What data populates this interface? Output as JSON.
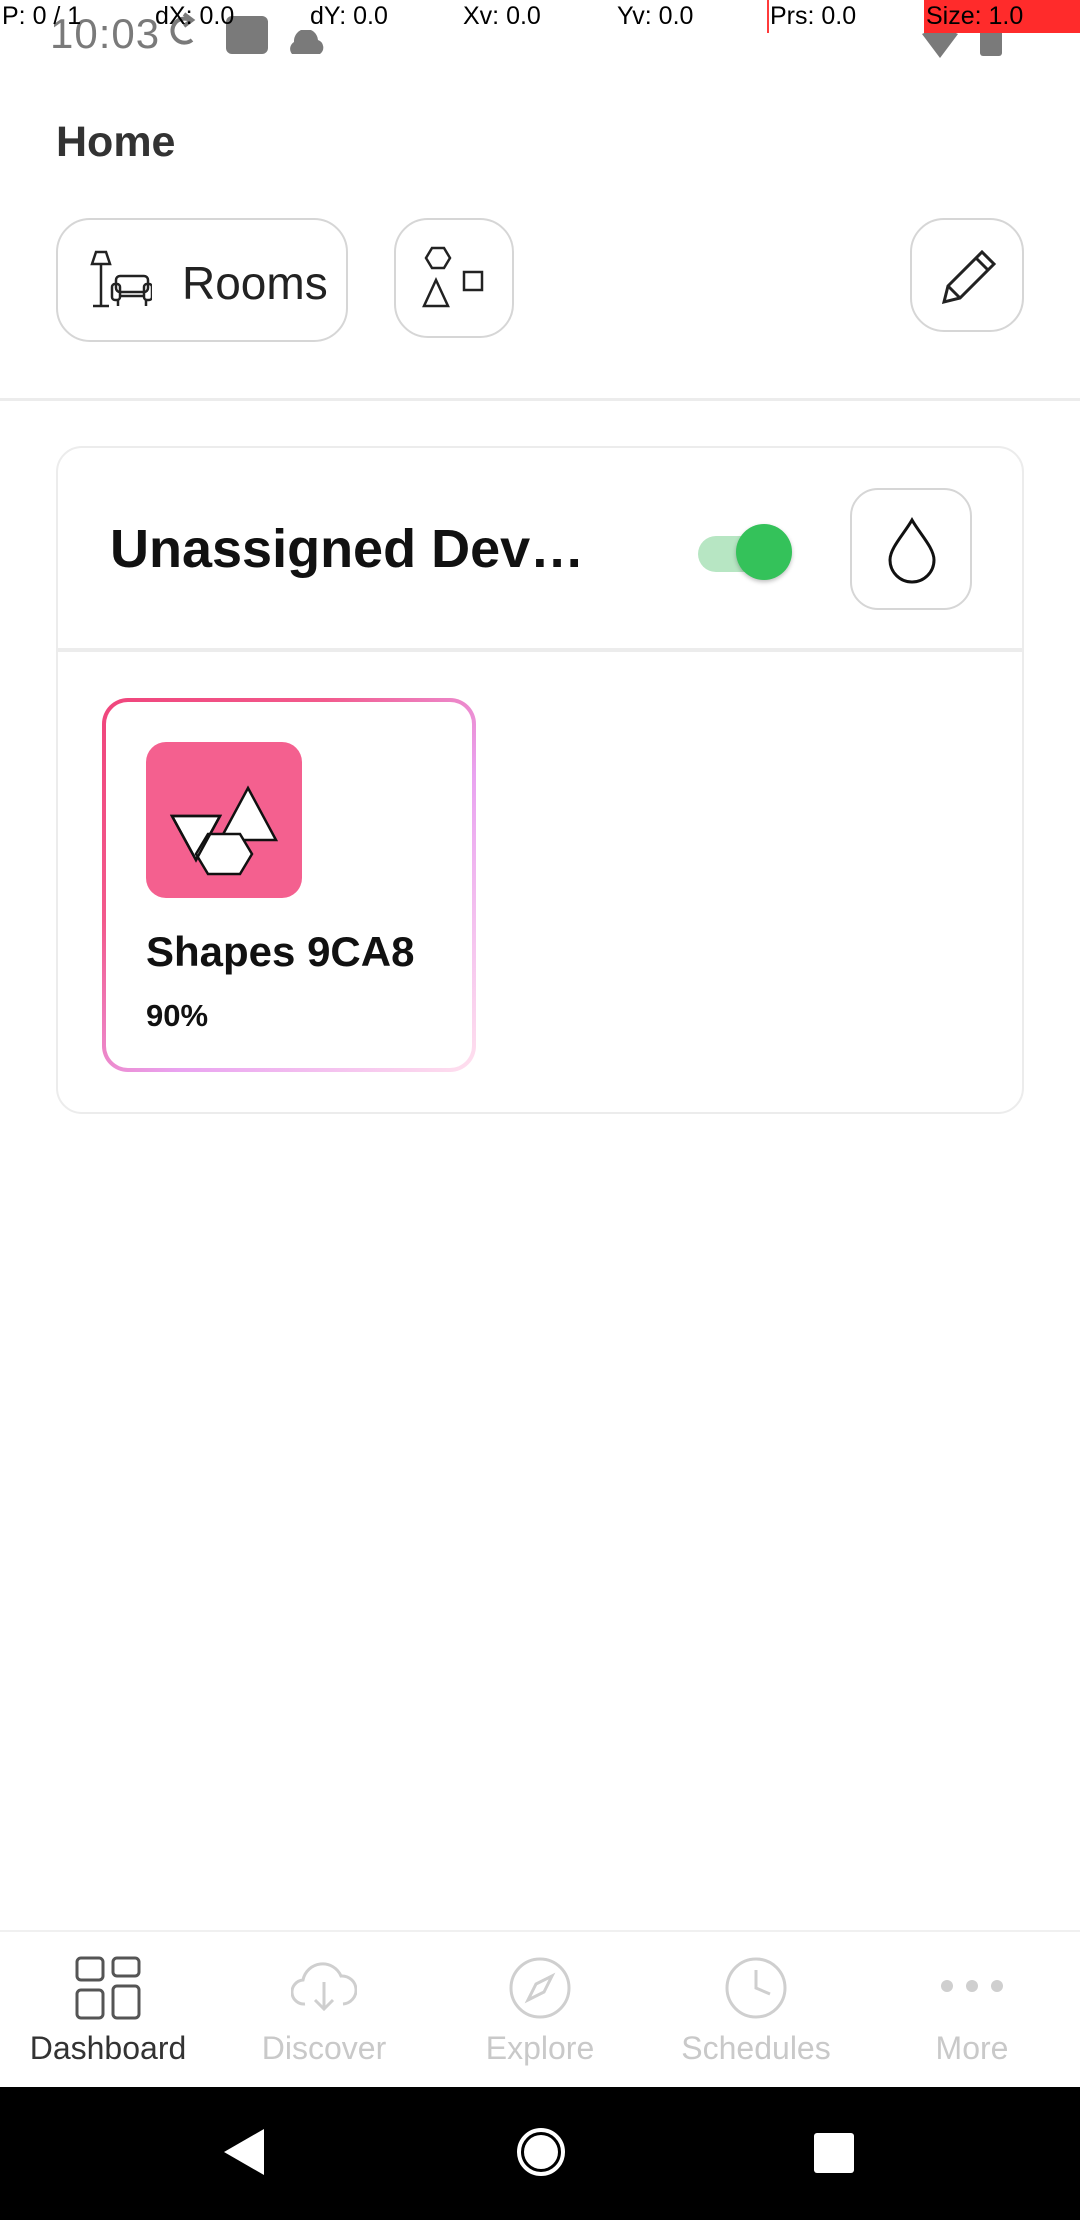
{
  "status_bar": {
    "time": "10:03"
  },
  "debug_overlay": {
    "p": "P: 0 / 1",
    "dx": "dX: 0.0",
    "dy": "dY: 0.0",
    "xv": "Xv: 0.0",
    "yv": "Yv: 0.0",
    "prs": "Prs: 0.0",
    "size": "Size: 1.0"
  },
  "header": {
    "title": "Home",
    "rooms_label": "Rooms"
  },
  "room_card": {
    "title": "Unassigned Devi...",
    "toggle_on": true,
    "devices": [
      {
        "name": "Shapes 9CA8",
        "level": "90%",
        "icon": "shapes-device-icon",
        "color": "#f4608f"
      }
    ]
  },
  "bottom_nav": {
    "items": [
      {
        "label": "Dashboard",
        "icon": "dashboard-icon",
        "active": true
      },
      {
        "label": "Discover",
        "icon": "download-cloud-icon",
        "active": false
      },
      {
        "label": "Explore",
        "icon": "compass-icon",
        "active": false
      },
      {
        "label": "Schedules",
        "icon": "clock-icon",
        "active": false
      },
      {
        "label": "More",
        "icon": "more-dots-icon",
        "active": false
      }
    ]
  },
  "colors": {
    "accent_toggle": "#34c25a",
    "device_pink": "#f4608f",
    "inactive_nav": "#c9c9c9"
  }
}
